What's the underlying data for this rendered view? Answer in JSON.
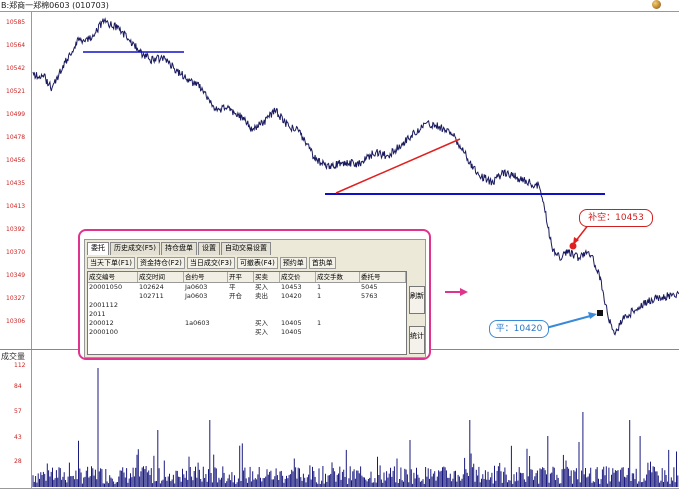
{
  "window": {
    "title": "B:郑商一郑棉0603 (010703)"
  },
  "price_axis": {
    "labels": [
      "10585",
      "10564",
      "10542",
      "10521",
      "10499",
      "10478",
      "10456",
      "10435",
      "10413",
      "10392",
      "10370",
      "10349",
      "10327",
      "10306"
    ]
  },
  "volume_panel": {
    "title": "成交量",
    "labels": [
      "112",
      "84",
      "57",
      "43",
      "28"
    ]
  },
  "annotations": {
    "short_open": "补空：10453",
    "flat_close": "平：10420"
  },
  "panel": {
    "caption": "",
    "main_tabs": [
      "委托",
      "历史成交(F5)",
      "持仓盘单",
      "设置",
      "自动交易设置"
    ],
    "active_tab": "委托",
    "sub_tabs": [
      "当天下单(F1)",
      "资金持仓(F2)",
      "当日成交(F3)",
      "可撤表(F4)",
      "预约单",
      "首执单"
    ],
    "columns": [
      "成交编号",
      "成交时间",
      "合约号",
      "开平",
      "买卖",
      "成交价",
      "成交手数",
      "委托号"
    ],
    "rows": [
      [
        "20001050",
        "102624",
        "Ja0603",
        "平",
        "买入",
        "10453",
        "1",
        "5045"
      ],
      [
        "",
        "102711",
        "Ja0603",
        "开仓",
        "卖出",
        "10420",
        "1",
        "5763"
      ],
      [
        "2001112",
        "",
        "",
        "",
        "",
        "",
        "",
        ""
      ],
      [
        "2011",
        "",
        "",
        "",
        "",
        "",
        "",
        ""
      ],
      [
        "200012",
        "",
        "1a0603",
        "",
        "买入",
        "10405",
        "1",
        ""
      ],
      [
        "2000100",
        "",
        "",
        "",
        "买入",
        "10405",
        "",
        ""
      ]
    ],
    "buttons": {
      "refresh": "刷新",
      "stats": "统计"
    }
  },
  "colors": {
    "price_line": "#1a1a5e",
    "volume_bars": "#1a1a7e",
    "support_line": "#1010c8",
    "trend_line": "#e02020",
    "panel_border": "#e0338f",
    "axis_label": "#c22222"
  }
}
